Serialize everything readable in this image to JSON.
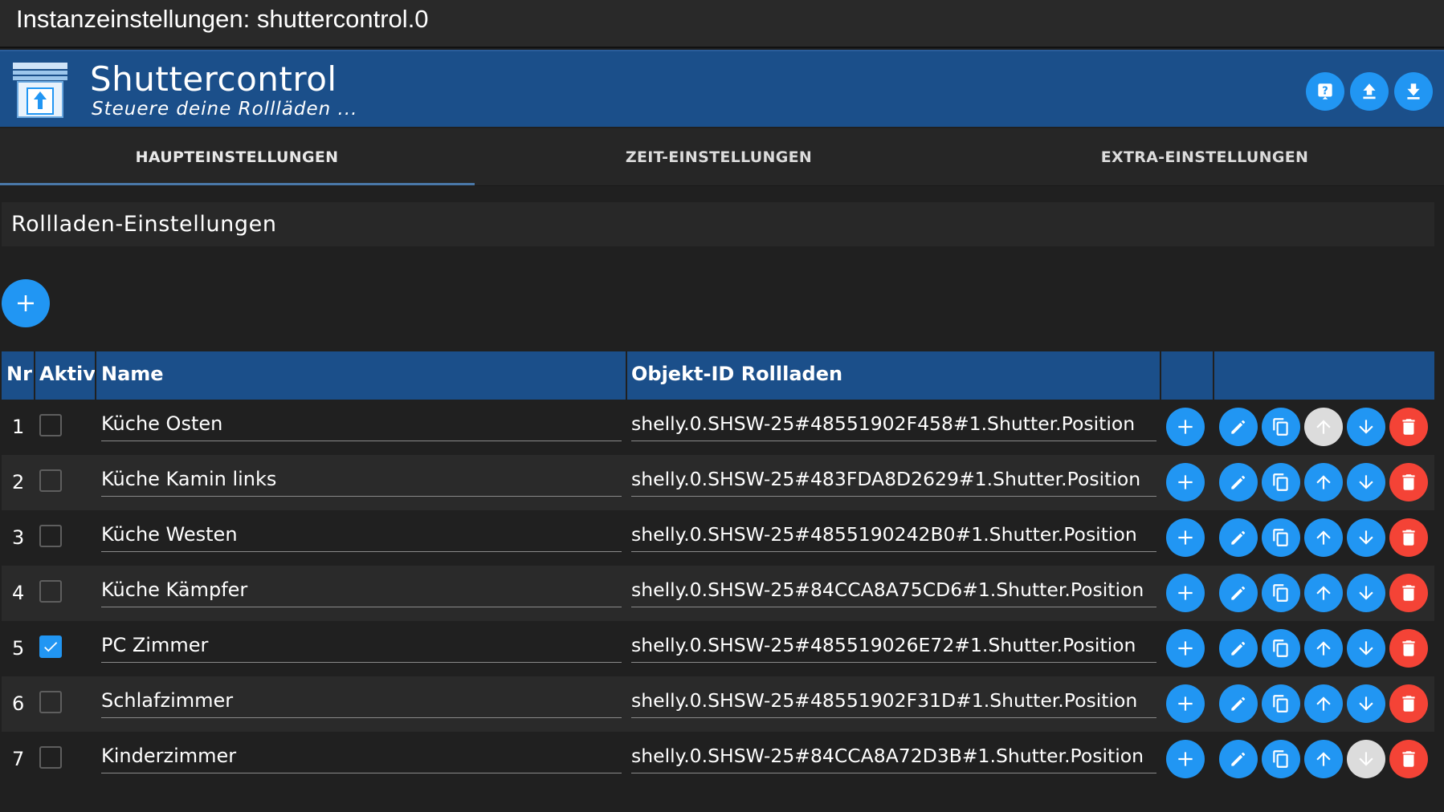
{
  "window": {
    "title": "Instanzeinstellungen: shuttercontrol.0"
  },
  "header": {
    "app_name": "Shuttercontrol",
    "subtitle": "Steuere deine Rollläden ...",
    "buttons": [
      "help-icon",
      "upload-icon",
      "download-icon"
    ]
  },
  "tabs": [
    {
      "label": "HAUPTEINSTELLUNGEN",
      "active": true
    },
    {
      "label": "ZEIT-EINSTELLUNGEN",
      "active": false
    },
    {
      "label": "EXTRA-EINSTELLUNGEN",
      "active": false
    }
  ],
  "section": {
    "title": "Rollladen-Einstellungen"
  },
  "table": {
    "headers": {
      "nr": "Nr",
      "active": "Aktiv",
      "name": "Name",
      "object_id": "Objekt-ID Rollladen"
    },
    "rows": [
      {
        "nr": "1",
        "active": false,
        "name": "Küche Osten",
        "object_id": "shelly.0.SHSW-25#48551902F458#1.Shutter.Position",
        "up_disabled": true,
        "down_disabled": false
      },
      {
        "nr": "2",
        "active": false,
        "name": "Küche Kamin links",
        "object_id": "shelly.0.SHSW-25#483FDA8D2629#1.Shutter.Position",
        "up_disabled": false,
        "down_disabled": false
      },
      {
        "nr": "3",
        "active": false,
        "name": "Küche Westen",
        "object_id": "shelly.0.SHSW-25#4855190242B0#1.Shutter.Position",
        "up_disabled": false,
        "down_disabled": false
      },
      {
        "nr": "4",
        "active": false,
        "name": "Küche Kämpfer",
        "object_id": "shelly.0.SHSW-25#84CCA8A75CD6#1.Shutter.Position",
        "up_disabled": false,
        "down_disabled": false
      },
      {
        "nr": "5",
        "active": true,
        "name": "PC Zimmer",
        "object_id": "shelly.0.SHSW-25#485519026E72#1.Shutter.Position",
        "up_disabled": false,
        "down_disabled": false
      },
      {
        "nr": "6",
        "active": false,
        "name": "Schlafzimmer",
        "object_id": "shelly.0.SHSW-25#48551902F31D#1.Shutter.Position",
        "up_disabled": false,
        "down_disabled": false
      },
      {
        "nr": "7",
        "active": false,
        "name": "Kinderzimmer",
        "object_id": "shelly.0.SHSW-25#84CCA8A72D3B#1.Shutter.Position",
        "up_disabled": false,
        "down_disabled": true
      }
    ],
    "row_actions": [
      "add-icon",
      "edit-icon",
      "copy-icon",
      "arrow-up-icon",
      "arrow-down-icon",
      "delete-icon"
    ]
  },
  "colors": {
    "accent": "#2196f3",
    "header_bg": "#1b4f8a",
    "danger": "#f44336",
    "disabled": "#dcdcdc",
    "background": "#202020"
  }
}
